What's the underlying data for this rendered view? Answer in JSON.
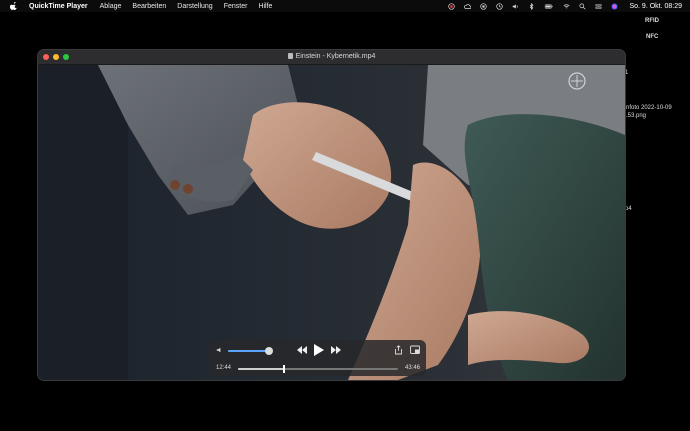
{
  "menubar": {
    "app_name": "QuickTime Player",
    "menus": [
      "Ablage",
      "Bearbeiten",
      "Darstellung",
      "Fenster",
      "Hilfe"
    ],
    "clock": "So. 9. Okt.  08:29"
  },
  "desktop": {
    "items": [
      "RFID",
      "NFC",
      "1",
      "nfoto 2022-10-09",
      ".53.png",
      "p4"
    ]
  },
  "window": {
    "title": "Einstein - Kybernetik.mp4",
    "controls": {
      "elapsed": "12:44",
      "remaining": "43:46",
      "progress": 0.29,
      "volume": 0.93
    }
  },
  "colors": {
    "close": "#ff5f57",
    "minimize": "#febc2e",
    "zoom": "#28c840",
    "accent": "#5aa4ff"
  }
}
